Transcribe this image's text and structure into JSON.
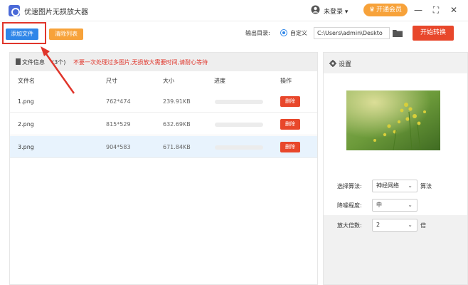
{
  "app": {
    "title": "优速图片无损放大器",
    "icon": "app-logo-icon"
  },
  "header": {
    "login_text": "未登录",
    "login_caret": "▾",
    "vip_label": "开通会员",
    "vip_icon": "crown-icon",
    "minimize": "—",
    "maximize": "⛶",
    "close": "✕"
  },
  "toolbar": {
    "add_label": "添加文件",
    "clear_label": "清除列表",
    "output_label": "输出目录:",
    "custom_label": "自定义",
    "output_path": "C:\\Users\\admin\\Deskto",
    "start_label": "开始转换"
  },
  "file_list": {
    "info_label": "文件信息",
    "count_text": "(3个)",
    "warning": "不要一次处理过多图片,无损放大需要时间,请耐心等待",
    "columns": {
      "name": "文件名",
      "size": "尺寸",
      "filesize": "大小",
      "progress": "进度",
      "action": "操作"
    },
    "rows": [
      {
        "name": "1.png",
        "size": "762*474",
        "filesize": "239.91KB",
        "progress": 0,
        "delete": "删除"
      },
      {
        "name": "2.png",
        "size": "815*529",
        "filesize": "632.69KB",
        "progress": 0,
        "delete": "删除"
      },
      {
        "name": "3.png",
        "size": "904*583",
        "filesize": "671.84KB",
        "progress": 0,
        "delete": "删除"
      }
    ],
    "selected_row": 2
  },
  "settings": {
    "title": "设置",
    "algorithm_label": "选择算法:",
    "algorithm_value": "神经网络",
    "algorithm_suffix": "算法",
    "denoise_label": "降噪程度:",
    "denoise_value": "中",
    "scale_label": "放大倍数:",
    "scale_value": "2",
    "scale_suffix": "倍",
    "caret": "⌄"
  },
  "colors": {
    "primary": "#2f86e8",
    "orange": "#f7a23a",
    "red": "#e8472b",
    "annotation": "#e0352b"
  }
}
